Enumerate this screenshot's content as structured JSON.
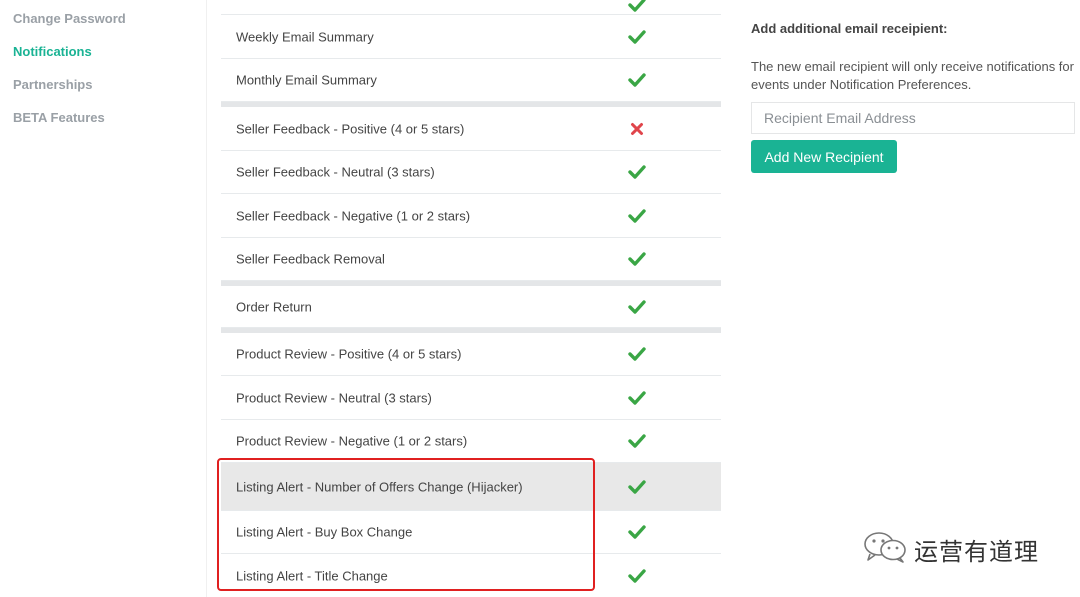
{
  "sidebar": {
    "items": [
      {
        "label": "Change Password",
        "active": false
      },
      {
        "label": "Notifications",
        "active": true
      },
      {
        "label": "Partnerships",
        "active": false
      },
      {
        "label": "BETA Features",
        "active": false
      }
    ]
  },
  "notifications": {
    "rows": [
      {
        "label": "Weekly Email Summary",
        "enabled": true
      },
      {
        "label": "Monthly Email Summary",
        "enabled": true
      },
      {
        "label": "Seller Feedback - Positive (4 or 5 stars)",
        "enabled": false
      },
      {
        "label": "Seller Feedback - Neutral (3 stars)",
        "enabled": true
      },
      {
        "label": "Seller Feedback - Negative (1 or 2 stars)",
        "enabled": true
      },
      {
        "label": "Seller Feedback Removal",
        "enabled": true
      },
      {
        "label": "Order Return",
        "enabled": true
      },
      {
        "label": "Product Review - Positive (4 or 5 stars)",
        "enabled": true
      },
      {
        "label": "Product Review - Neutral (3 stars)",
        "enabled": true
      },
      {
        "label": "Product Review - Negative (1 or 2 stars)",
        "enabled": true
      },
      {
        "label": "Listing Alert - Number of Offers Change (Hijacker)",
        "enabled": true
      },
      {
        "label": "Listing Alert - Buy Box Change",
        "enabled": true
      },
      {
        "label": "Listing Alert - Title Change",
        "enabled": true
      }
    ]
  },
  "recipient_panel": {
    "title": "Add additional email receipient:",
    "description": "The new email recipient will only receive notifications for events under Notification Preferences.",
    "input_placeholder": "Recipient Email Address",
    "input_value": "",
    "button_label": "Add New Recipient"
  },
  "watermark": {
    "text": "运营有道理"
  },
  "colors": {
    "accent": "#1ab394",
    "check": "#3aa645",
    "cross": "#e0454b",
    "annotation": "#e02020"
  },
  "icons": {
    "enabled": "check-icon",
    "disabled": "cross-icon"
  }
}
